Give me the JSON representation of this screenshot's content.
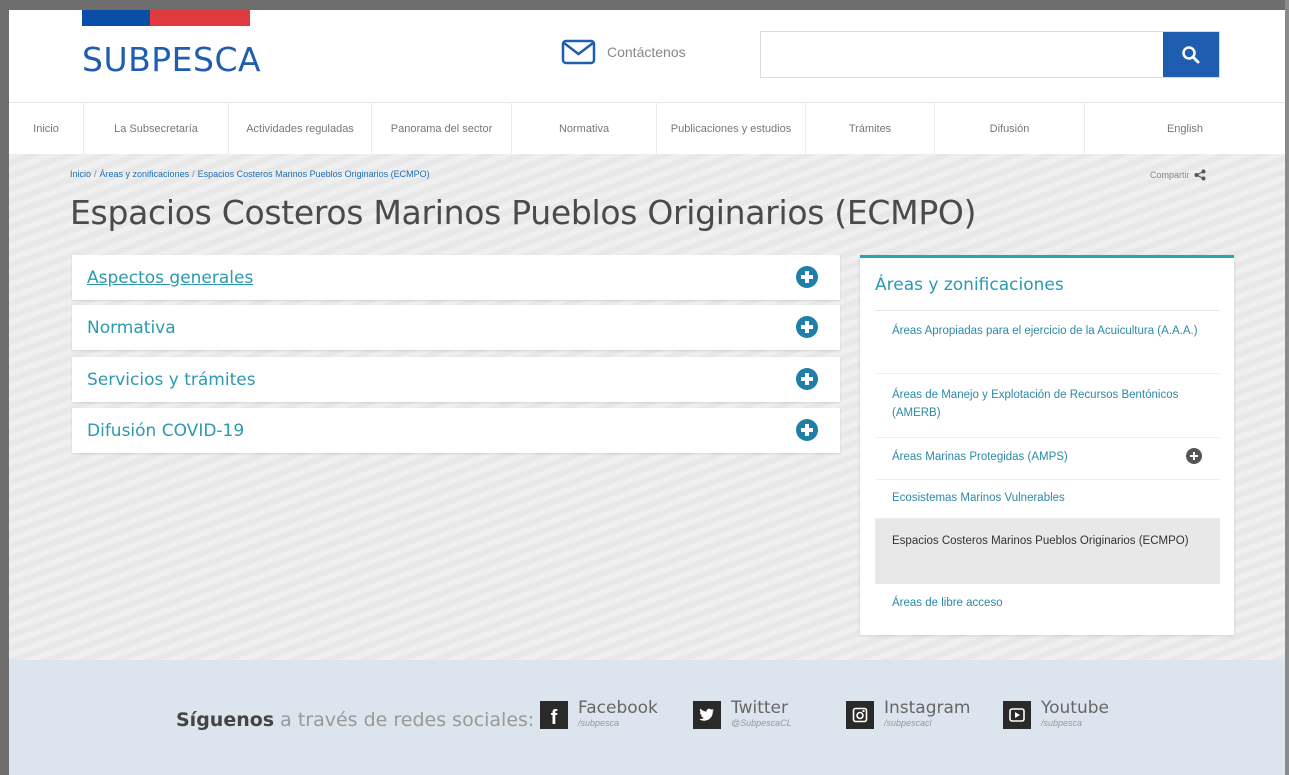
{
  "brand": {
    "logo_text": "SUBPESCA",
    "colors": {
      "blue": "#0a4ea8",
      "red": "#e03a3e",
      "accent": "#2b9ab0"
    }
  },
  "header": {
    "contact_label": "Contáctenos",
    "contact_icon": "envelope-icon",
    "search_value": "",
    "search_icon": "search-icon"
  },
  "nav": {
    "items": [
      "Inicio",
      "La Subsecretaría",
      "Actividades reguladas",
      "Panorama del sector",
      "Normativa",
      "Publicaciones y estudios",
      "Trámites",
      "Difusión",
      "English"
    ]
  },
  "breadcrumb": {
    "home": "Inicio",
    "section": "Áreas y zonificaciones",
    "current": "Espacios Costeros Marinos Pueblos Originarios (ECMPO)",
    "separator": "/"
  },
  "share": {
    "label": "Compartir",
    "icon": "share-icon"
  },
  "page": {
    "title": "Espacios Costeros Marinos Pueblos Originarios (ECMPO)"
  },
  "accordion": {
    "items": [
      "Aspectos generales",
      "Normativa",
      "Servicios y trámites",
      "Difusión COVID-19"
    ],
    "icon": "plus-circle-icon"
  },
  "sidebar": {
    "heading": "Áreas y zonificaciones",
    "links": [
      "Áreas Apropiadas para el ejercicio de la Acuicultura (A.A.A.)",
      "Áreas de Manejo y Explotación de Recursos Bentónicos (AMERB)",
      "Áreas Marinas Protegidas (AMPS)",
      "Ecosistemas Marinos Vulnerables",
      "Espacios Costeros Marinos Pueblos Originarios (ECMPO)",
      "Áreas de libre acceso"
    ]
  },
  "footer": {
    "follow_bold": "Síguenos",
    "follow_rest": " a través de redes sociales:",
    "socials": [
      {
        "name": "Facebook",
        "handle": "/subpesca",
        "icon": "facebook-icon"
      },
      {
        "name": "Twitter",
        "handle": "@SubpescaCL",
        "icon": "twitter-icon"
      },
      {
        "name": "Instagram",
        "handle": "/subpescacl",
        "icon": "instagram-icon"
      },
      {
        "name": "Youtube",
        "handle": "/subpesca",
        "icon": "youtube-icon"
      }
    ]
  }
}
